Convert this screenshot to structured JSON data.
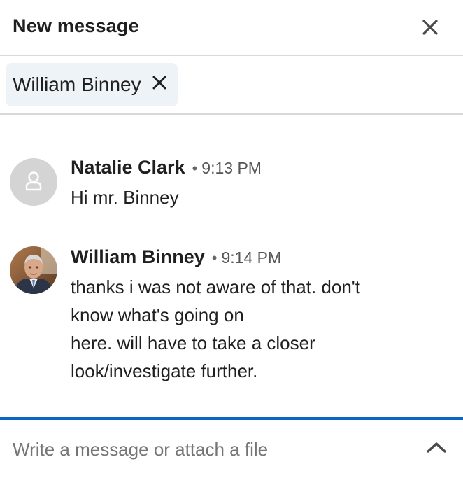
{
  "header": {
    "title": "New message",
    "close_icon": "close-icon"
  },
  "recipients": [
    {
      "name": "William Binney",
      "remove_icon": "close-icon"
    }
  ],
  "thread": {
    "messages": [
      {
        "sender": "Natalie Clark",
        "time": "9:13 PM",
        "avatar": "default-person-icon",
        "body": "Hi mr. Binney"
      },
      {
        "sender": "William Binney",
        "time": "9:14 PM",
        "avatar": "profile-photo",
        "body": "thanks i was not aware of that.  don't\nknow what's going on\nhere.  will have to take a closer\nlook/investigate further."
      }
    ]
  },
  "composer": {
    "placeholder": "Write a message or attach a file",
    "value": "",
    "expand_icon": "chevron-up-icon"
  },
  "colors": {
    "accent": "#0a66c2",
    "chip_bg": "#eef3f8",
    "divider": "#d9d9d9",
    "avatar_placeholder": "#d4d4d4"
  }
}
